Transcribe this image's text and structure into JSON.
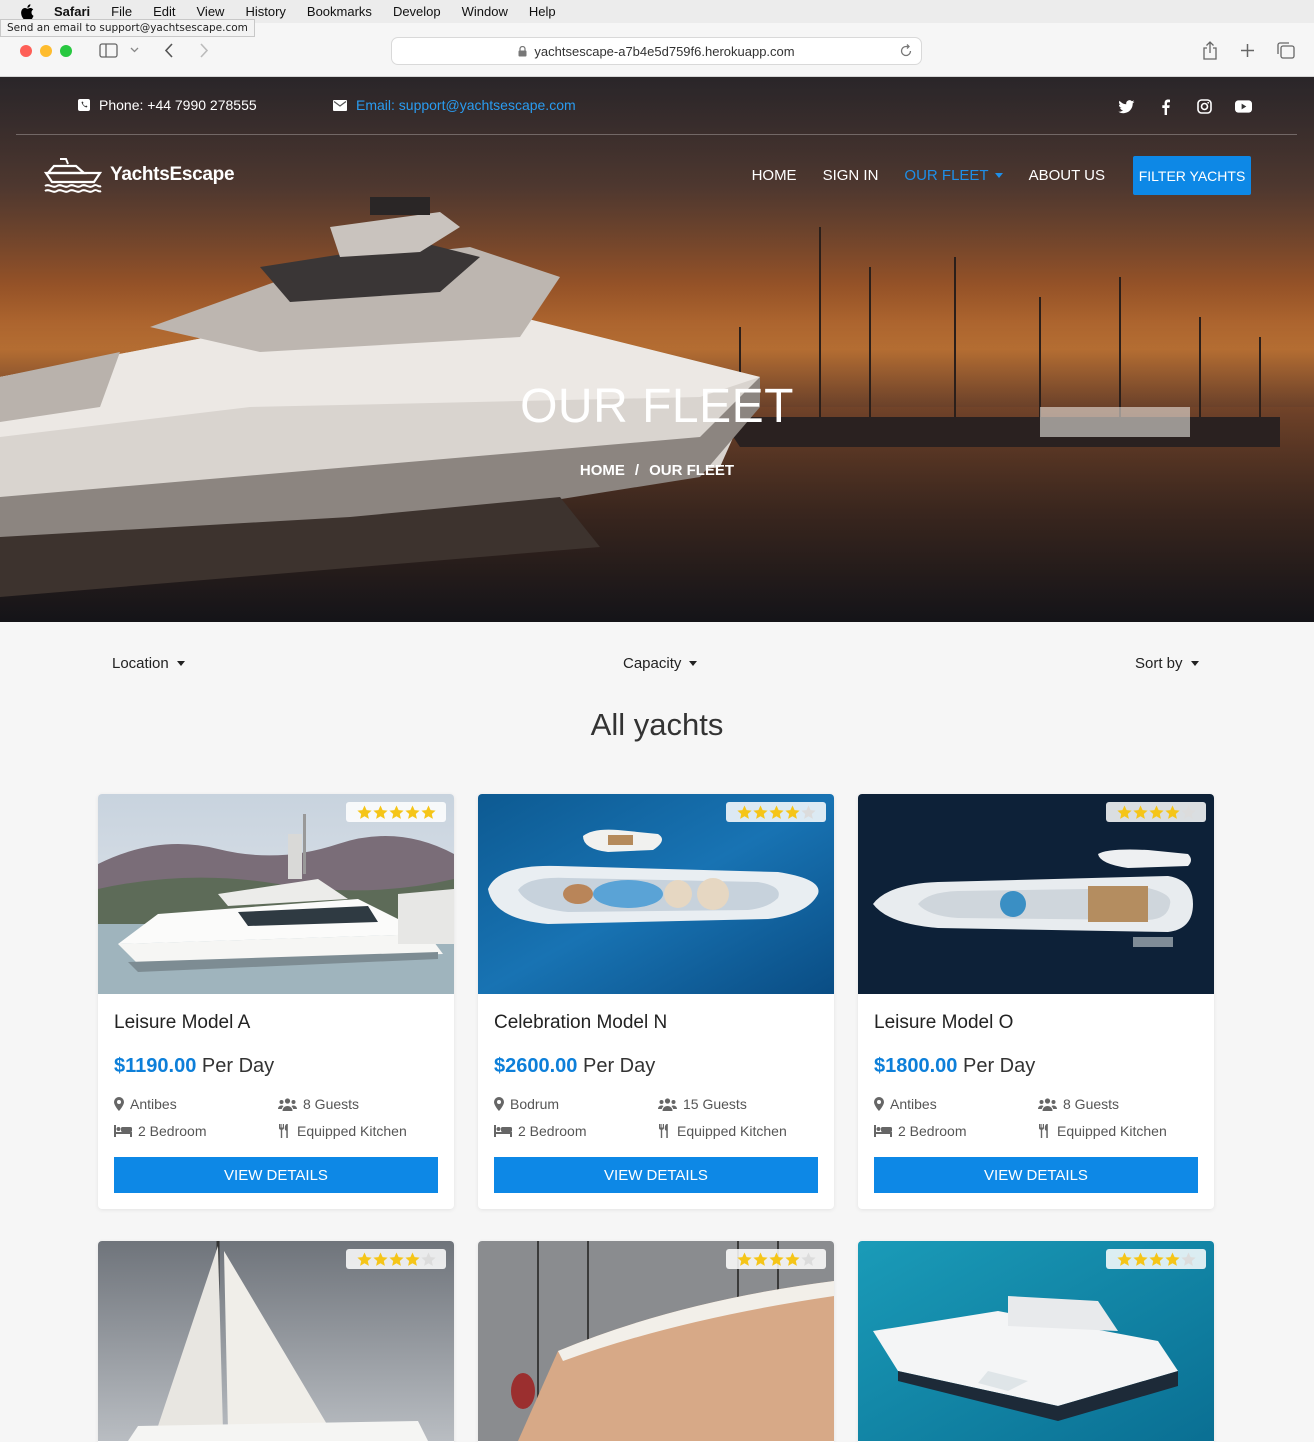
{
  "menubar": {
    "app": "Safari",
    "items": [
      "File",
      "Edit",
      "View",
      "History",
      "Bookmarks",
      "Develop",
      "Window",
      "Help"
    ]
  },
  "status_tip": "Send an email to support@yachtsescape.com",
  "browser": {
    "url": "yachtsescape-a7b4e5d759f6.herokuapp.com"
  },
  "topbar": {
    "phone": "Phone: +44 7990 278555",
    "email": "Email: support@yachtsescape.com",
    "social": [
      "twitter-icon",
      "facebook-icon",
      "instagram-icon",
      "youtube-icon"
    ]
  },
  "navbar": {
    "logo": "YachtsEscape",
    "items": {
      "home": "HOME",
      "signin": "SIGN IN",
      "fleet": "OUR FLEET",
      "about": "ABOUT US"
    },
    "filter_button": "FILTER YACHTS"
  },
  "hero": {
    "title": "OUR FLEET",
    "crumb_home": "HOME",
    "crumb_sep": "/",
    "crumb_current": "OUR FLEET"
  },
  "filters": {
    "location": "Location",
    "capacity": "Capacity",
    "sort": "Sort by"
  },
  "section_title": "All yachts",
  "colors": {
    "accent": "#0d88e6",
    "price": "#0d7fd9",
    "star": "#f5c518"
  },
  "yachts": [
    {
      "name": "Leisure Model A",
      "price": "$1190.00",
      "per": "Per Day",
      "location": "Antibes",
      "guests": "8 Guests",
      "bedrooms": "2 Bedroom",
      "kitchen": "Equipped Kitchen",
      "rating": 5,
      "button": "VIEW DETAILS"
    },
    {
      "name": "Celebration Model N",
      "price": "$2600.00",
      "per": "Per Day",
      "location": "Bodrum",
      "guests": "15 Guests",
      "bedrooms": "2 Bedroom",
      "kitchen": "Equipped Kitchen",
      "rating": 4,
      "button": "VIEW DETAILS"
    },
    {
      "name": "Leisure Model O",
      "price": "$1800.00",
      "per": "Per Day",
      "location": "Antibes",
      "guests": "8 Guests",
      "bedrooms": "2 Bedroom",
      "kitchen": "Equipped Kitchen",
      "rating": 4,
      "button": "VIEW DETAILS"
    },
    {
      "rating": 4
    },
    {
      "rating": 4
    },
    {
      "rating": 4
    }
  ]
}
